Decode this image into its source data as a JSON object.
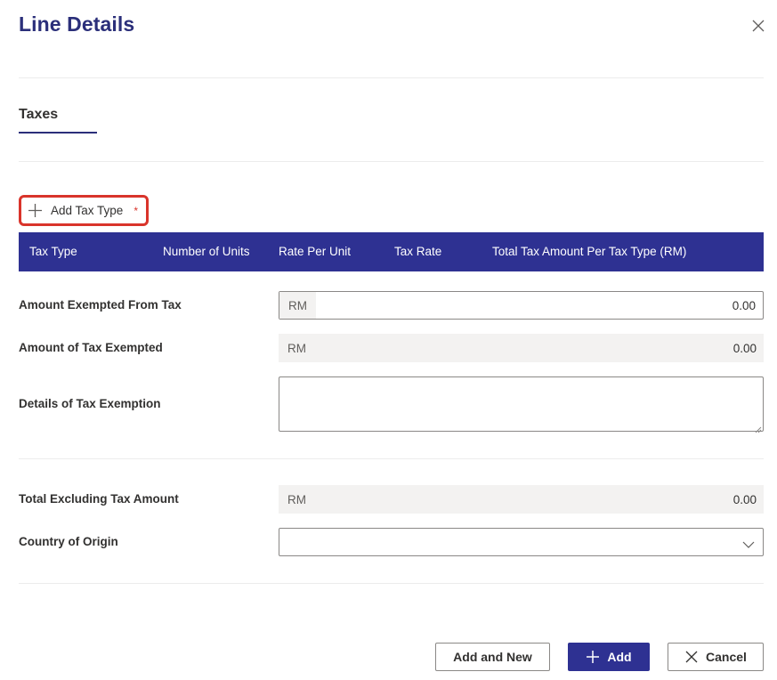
{
  "dialog": {
    "title": "Line Details",
    "close_icon": "close-icon"
  },
  "section": {
    "tab_label": "Taxes"
  },
  "add_tax_type": {
    "label": "Add Tax Type",
    "required_marker": "*",
    "icon": "plus-icon"
  },
  "tax_table": {
    "header_color": "#2e3192",
    "columns": [
      "Tax Type",
      "Number of Units",
      "Rate Per Unit",
      "Tax Rate",
      "Total Tax Amount Per Tax Type (RM)"
    ]
  },
  "fields": {
    "amount_exempted": {
      "label": "Amount Exempted From Tax",
      "prefix": "RM",
      "value": "0.00"
    },
    "tax_exempted": {
      "label": "Amount of Tax Exempted",
      "prefix": "RM",
      "value": "0.00"
    },
    "exemption_details": {
      "label": "Details of Tax Exemption",
      "value": ""
    },
    "total_excl_tax": {
      "label": "Total Excluding Tax Amount",
      "prefix": "RM",
      "value": "0.00"
    },
    "country_of_origin": {
      "label": "Country of Origin",
      "value": "",
      "icon": "chevron-down-icon"
    }
  },
  "footer": {
    "add_and_new_label": "Add and New",
    "add_label": "Add",
    "cancel_label": "Cancel"
  },
  "colors": {
    "accent": "#2e3192",
    "title": "#2b2f7a",
    "highlight_border": "#d9342b",
    "readonly_bg": "#f3f2f1"
  }
}
